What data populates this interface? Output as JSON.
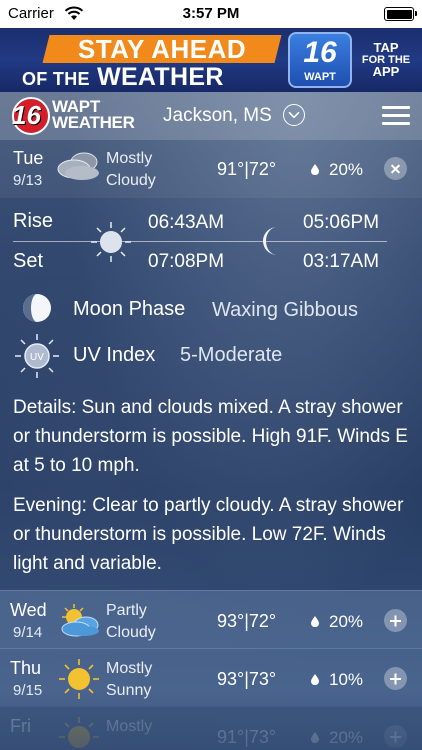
{
  "status_bar": {
    "carrier": "Carrier",
    "time": "3:57 PM"
  },
  "ad": {
    "line1": "STAY AHEAD",
    "line2_pre": "OF THE",
    "line2_main": "WEATHER",
    "logo_number": "16",
    "logo_label": "WAPT",
    "tap_line1": "TAP",
    "tap_line2": "FOR THE",
    "tap_line3": "APP"
  },
  "header": {
    "logo_number": "16",
    "logo_line1": "WAPT",
    "logo_line2": "WEATHER",
    "location": "Jackson, MS"
  },
  "today": {
    "day": "Tue",
    "date": "9/13",
    "condition_line1": "Mostly",
    "condition_line2": "Cloudy",
    "temps": "91°|72°",
    "precip": "20%",
    "icon": "mostly-cloudy-icon"
  },
  "sun_moon": {
    "rise_label": "Rise",
    "set_label": "Set",
    "sunrise": "06:43AM",
    "sunset": "07:08PM",
    "moonrise": "05:06PM",
    "moonset": "03:17AM"
  },
  "moon_phase": {
    "label": "Moon Phase",
    "value": "Waxing Gibbous"
  },
  "uv_index": {
    "label": "UV Index",
    "value": "5-Moderate",
    "icon_text": "UV"
  },
  "details": "Details: Sun and clouds mixed. A stray shower or thunderstorm is possible. High 91F. Winds E at 5 to 10 mph.",
  "evening": "Evening: Clear to partly cloudy. A stray shower or thunderstorm is possible. Low 72F. Winds light and variable.",
  "forecast": [
    {
      "day": "Wed",
      "date": "9/14",
      "condition_line1": "Partly",
      "condition_line2": "Cloudy",
      "temps": "93°|72°",
      "precip": "20%",
      "icon": "partly-cloudy-icon"
    },
    {
      "day": "Thu",
      "date": "9/15",
      "condition_line1": "Mostly",
      "condition_line2": "Sunny",
      "temps": "93°|73°",
      "precip": "10%",
      "icon": "mostly-sunny-icon"
    },
    {
      "day": "Fri",
      "date": "",
      "condition_line1": "Mostly",
      "condition_line2": "",
      "temps": "91°|73°",
      "precip": "20%",
      "icon": "mostly-sunny-icon"
    }
  ],
  "colors": {
    "accent_red": "#d41f2a",
    "ad_orange": "#f28a1b",
    "ad_blue": "#213a84",
    "sun_yellow": "#f3c230"
  }
}
